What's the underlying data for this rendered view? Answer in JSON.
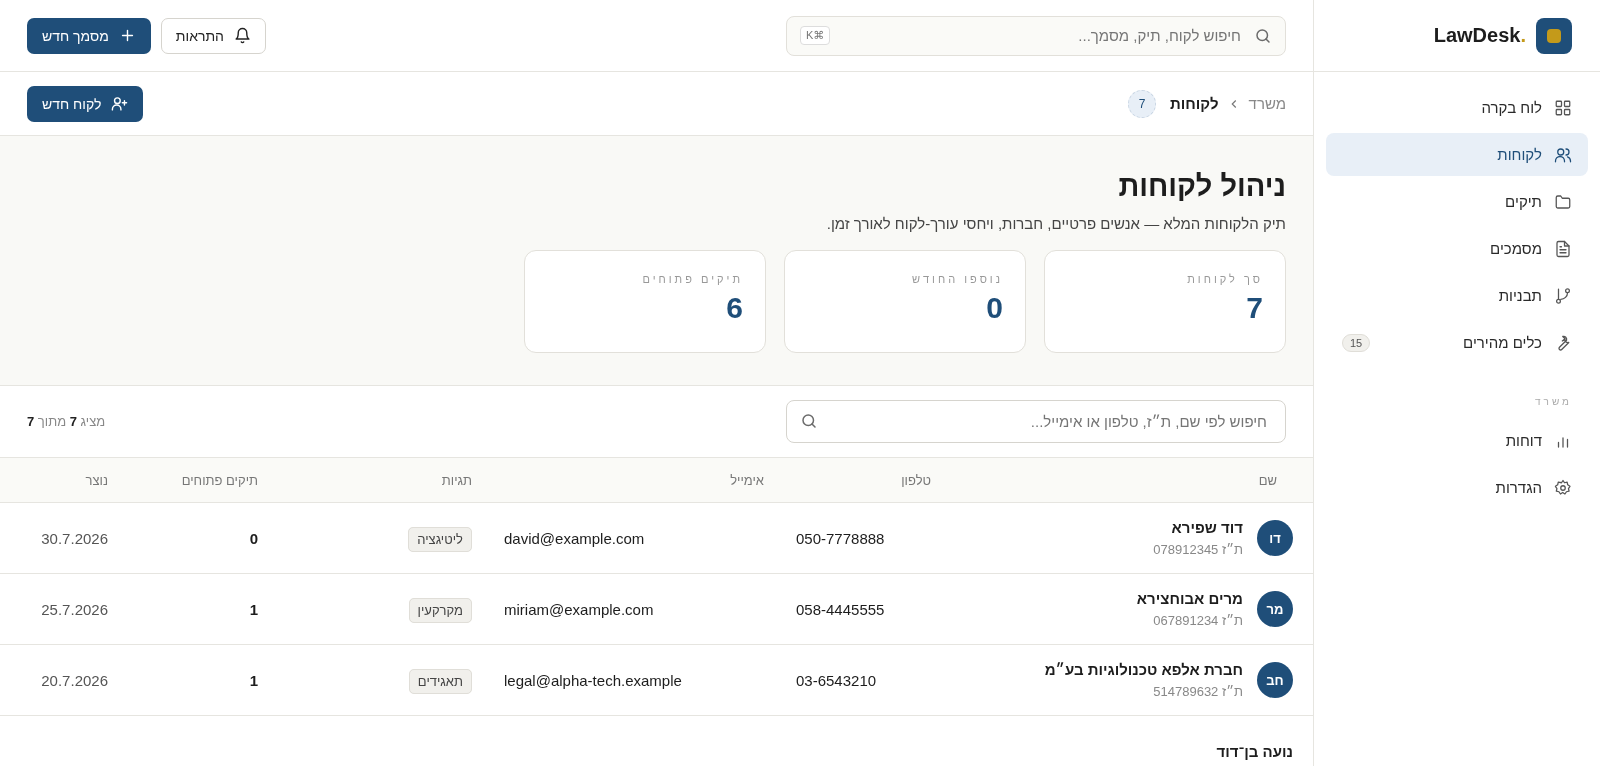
{
  "brand": {
    "name": "LawDesk",
    "dot": "."
  },
  "topbar": {
    "search_placeholder": "חיפוש לקוח, תיק, מסמך...",
    "shortcut": "⌘K",
    "buttons": [
      {
        "kind": "outline",
        "label": "התראות"
      },
      {
        "kind": "primary",
        "label": "מסמך חדש"
      }
    ]
  },
  "sidebar": {
    "items": [
      {
        "label": "לוח בקרה",
        "selected": false
      },
      {
        "label": "לקוחות",
        "selected": true
      },
      {
        "label": "תיקים",
        "selected": false
      },
      {
        "label": "מסמכים",
        "selected": false
      },
      {
        "label": "תבניות",
        "selected": false
      },
      {
        "label": "כלים מהירים",
        "selected": false,
        "badge": "15"
      }
    ],
    "section_title": "משרד",
    "section_items": [
      {
        "label": "דוחות",
        "selected": false
      },
      {
        "label": "הגדרות",
        "selected": false
      }
    ]
  },
  "breadcrumb": {
    "parent": "משרד",
    "current": "לקוחות",
    "count": "7"
  },
  "new_client_button": "לקוח חדש",
  "page": {
    "title": "ניהול לקוחות",
    "subtitle": "תיק הלקוחות המלא — אנשים פרטיים, חברות, ויחסי עורך-לקוח לאורך זמן."
  },
  "stats": [
    {
      "label": "סך לקוחות",
      "value": "7"
    },
    {
      "label": "נוספו החודש",
      "value": "0"
    },
    {
      "label": "תיקים פתוחים",
      "value": "6"
    }
  ],
  "filter": {
    "placeholder": "חיפוש לפי שם, ת״ז, טלפון או אימייל...",
    "count": "מציג **7** מתוך **7**"
  },
  "table": {
    "columns": [
      "שם",
      "טלפון",
      "אימייל",
      "תגיות",
      "תיקים פתוחים",
      "נוצר"
    ],
    "rows": [
      {
        "initials": "דו",
        "name": "דוד שפירא",
        "id": "ת״ז 078912345",
        "phone": "050-7778888",
        "email": "david@example.com",
        "tag": "ליטיגציה",
        "open_cases": "0",
        "created": "30.7.2026"
      },
      {
        "initials": "מר",
        "name": "מרים אבוחצירא",
        "id": "ת״ז 067891234",
        "phone": "058-4445555",
        "email": "miriam@example.com",
        "tag": "מקרקעין",
        "open_cases": "1",
        "created": "25.7.2026"
      },
      {
        "initials": "חב",
        "name": "חברת אלפא טכנולוגיות בע״מ",
        "id": "ת״ז 514789632",
        "phone": "03-6543210",
        "email": "legal@alpha-tech.example",
        "tag": "תאגידים",
        "open_cases": "1",
        "created": "20.7.2026"
      },
      {
        "name": "נועה בן־דוד"
      }
    ]
  }
}
